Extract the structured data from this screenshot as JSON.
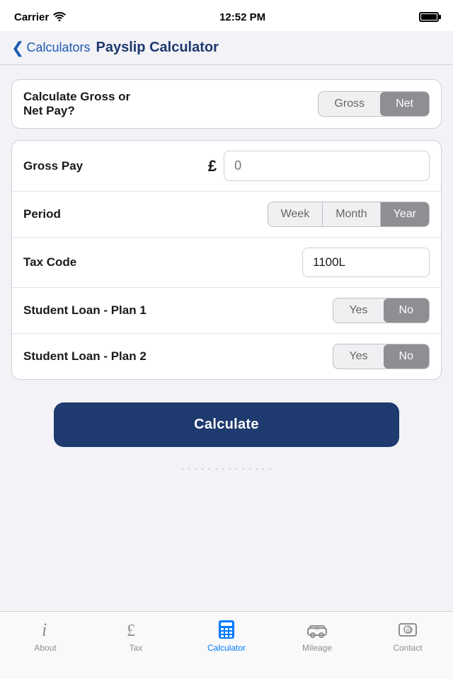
{
  "statusBar": {
    "carrier": "Carrier",
    "time": "12:52 PM"
  },
  "navBar": {
    "backLabel": "Calculators",
    "title": "Payslip Calculator"
  },
  "grossNetRow": {
    "label": "Calculate Gross or\nNet Pay?",
    "options": [
      "Gross",
      "Net"
    ],
    "selected": "Net"
  },
  "grossPayRow": {
    "label": "Gross Pay",
    "currencySymbol": "£",
    "placeholder": "0"
  },
  "periodRow": {
    "label": "Period",
    "options": [
      "Week",
      "Month",
      "Year"
    ],
    "selected": "Year"
  },
  "taxCodeRow": {
    "label": "Tax Code",
    "value": "1100L"
  },
  "studentLoan1Row": {
    "label": "Student Loan - Plan 1",
    "options": [
      "Yes",
      "No"
    ],
    "selected": "No"
  },
  "studentLoan2Row": {
    "label": "Student Loan - Plan 2",
    "options": [
      "Yes",
      "No"
    ],
    "selected": "No"
  },
  "calculateButton": {
    "label": "Calculate"
  },
  "tabBar": {
    "items": [
      {
        "id": "about",
        "label": "About",
        "active": false
      },
      {
        "id": "tax",
        "label": "Tax",
        "active": false
      },
      {
        "id": "calculator",
        "label": "Calculator",
        "active": true
      },
      {
        "id": "mileage",
        "label": "Mileage",
        "active": false
      },
      {
        "id": "contact",
        "label": "Contact",
        "active": false
      }
    ]
  }
}
